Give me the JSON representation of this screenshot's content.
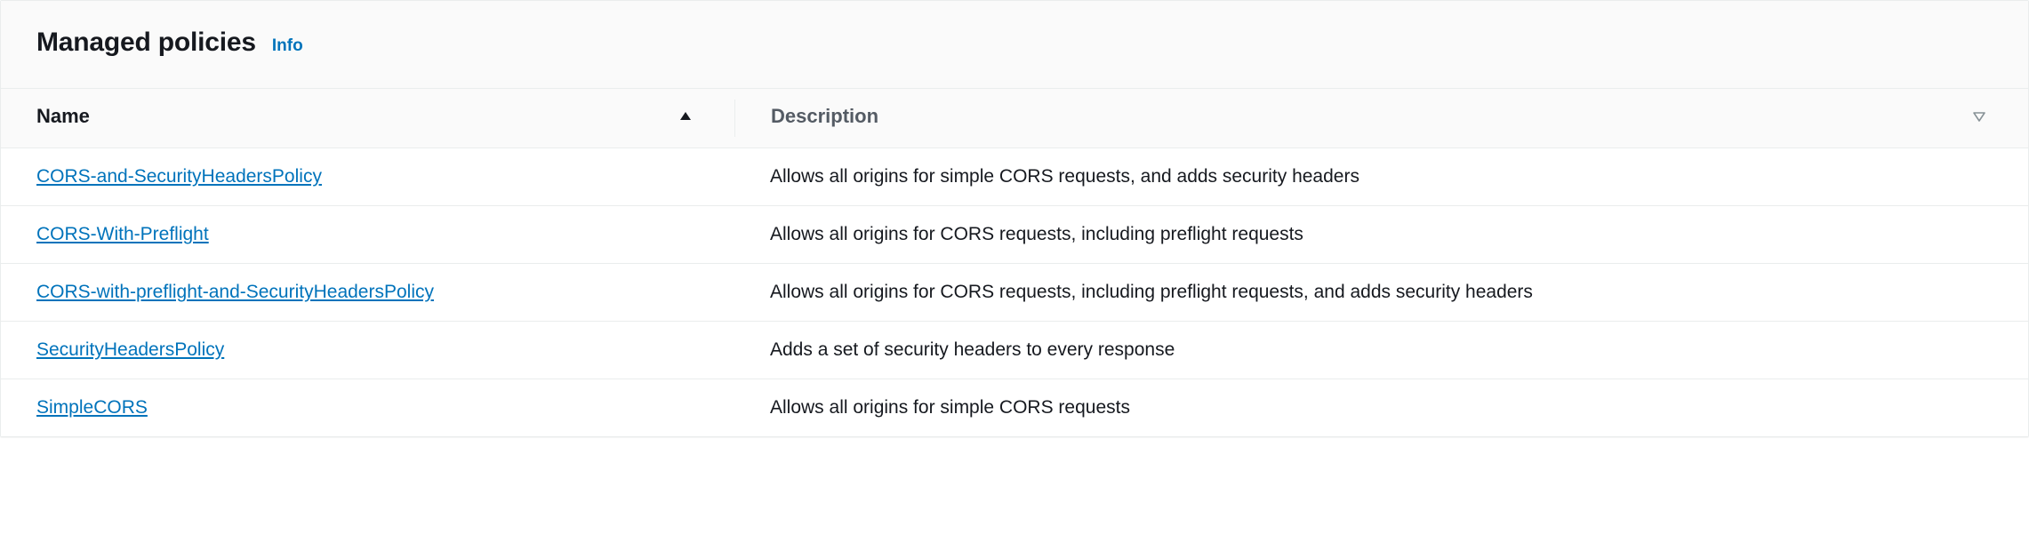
{
  "header": {
    "title": "Managed policies",
    "info_label": "Info"
  },
  "table": {
    "columns": {
      "name": "Name",
      "description": "Description"
    },
    "rows": [
      {
        "name": "CORS-and-SecurityHeadersPolicy",
        "description": "Allows all origins for simple CORS requests, and adds security headers"
      },
      {
        "name": "CORS-With-Preflight",
        "description": "Allows all origins for CORS requests, including preflight requests"
      },
      {
        "name": "CORS-with-preflight-and-SecurityHeadersPolicy",
        "description": "Allows all origins for CORS requests, including preflight requests, and adds security headers"
      },
      {
        "name": "SecurityHeadersPolicy",
        "description": "Adds a set of security headers to every response"
      },
      {
        "name": "SimpleCORS",
        "description": "Allows all origins for simple CORS requests"
      }
    ]
  }
}
